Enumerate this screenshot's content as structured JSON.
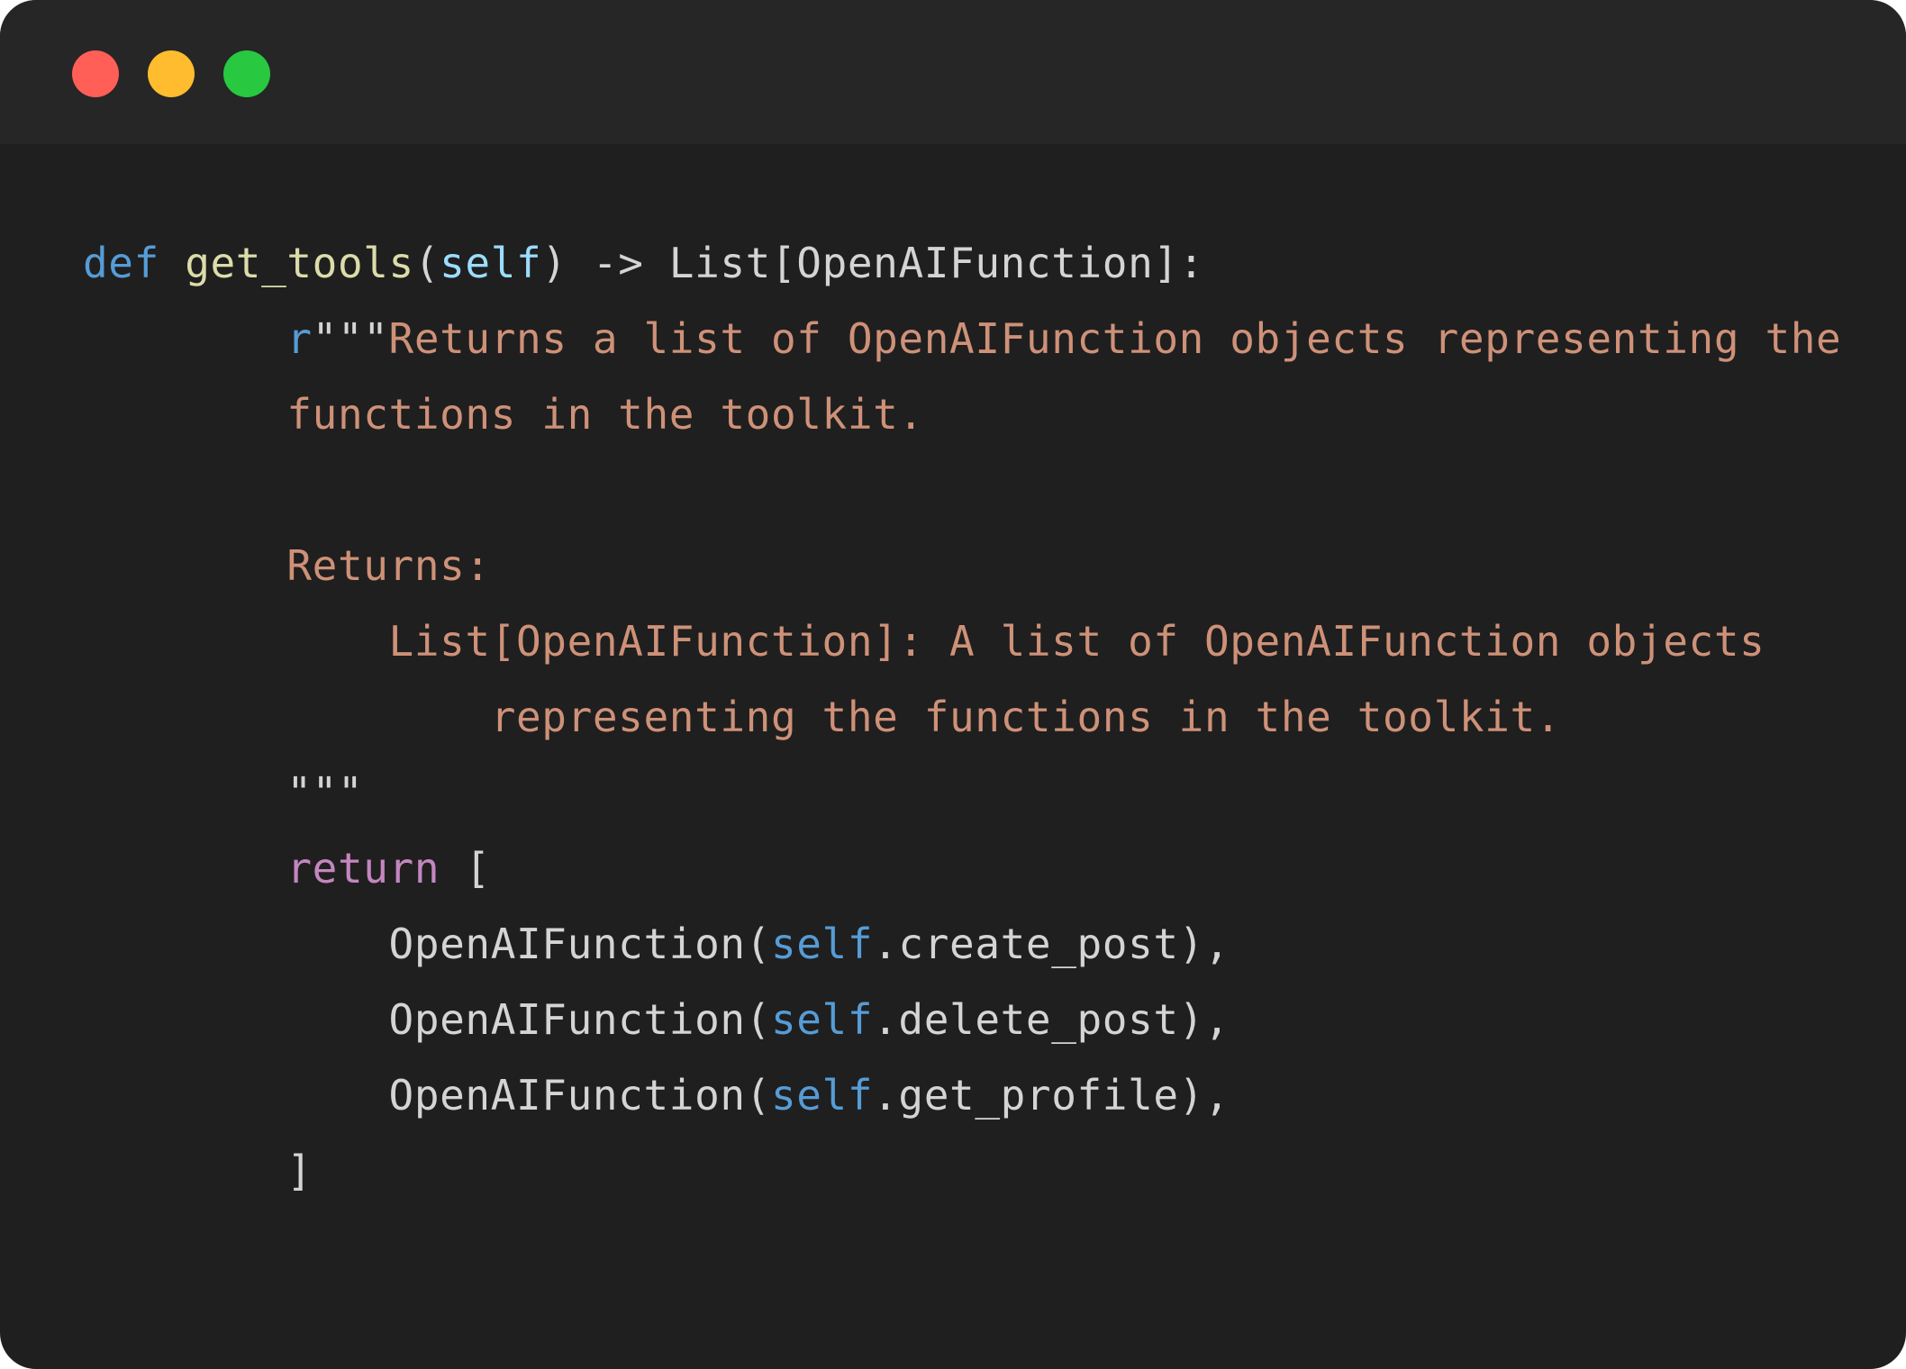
{
  "window": {
    "controls": {
      "close_color": "#ff5f57",
      "minimize_color": "#febc2e",
      "maximize_color": "#28c840"
    }
  },
  "theme": {
    "background": "#1f1f1f",
    "titlebar": "#262626",
    "keyword": "#569cd6",
    "function": "#dcdcaa",
    "param": "#9cdcfe",
    "default": "#d4d4d4",
    "string": "#ce9178",
    "control": "#c586c0"
  },
  "code": {
    "lines": [
      {
        "tokens": [
          {
            "t": "def",
            "c": "keyword"
          },
          {
            "t": " ",
            "c": "default"
          },
          {
            "t": "get_tools",
            "c": "function"
          },
          {
            "t": "(",
            "c": "default"
          },
          {
            "t": "self",
            "c": "param"
          },
          {
            "t": ") -> List[OpenAIFunction]:",
            "c": "default"
          }
        ]
      },
      {
        "tokens": [
          {
            "t": "        ",
            "c": "default"
          },
          {
            "t": "r",
            "c": "keyword"
          },
          {
            "t": "\"\"\"",
            "c": "default"
          },
          {
            "t": "Returns a list of OpenAIFunction objects representing the",
            "c": "string"
          }
        ]
      },
      {
        "tokens": [
          {
            "t": "        functions in the toolkit.",
            "c": "string"
          }
        ]
      },
      {
        "tokens": [
          {
            "t": "",
            "c": "string"
          }
        ]
      },
      {
        "tokens": [
          {
            "t": "        Returns:",
            "c": "string"
          }
        ]
      },
      {
        "tokens": [
          {
            "t": "            List[OpenAIFunction]: A list of OpenAIFunction objects",
            "c": "string"
          }
        ]
      },
      {
        "tokens": [
          {
            "t": "                representing the functions in the toolkit.",
            "c": "string"
          }
        ]
      },
      {
        "tokens": [
          {
            "t": "        \"\"\"",
            "c": "default"
          }
        ]
      },
      {
        "tokens": [
          {
            "t": "        ",
            "c": "default"
          },
          {
            "t": "return",
            "c": "control"
          },
          {
            "t": " [",
            "c": "default"
          }
        ]
      },
      {
        "tokens": [
          {
            "t": "            OpenAIFunction(",
            "c": "default"
          },
          {
            "t": "self",
            "c": "keyword"
          },
          {
            "t": ".create_post),",
            "c": "default"
          }
        ]
      },
      {
        "tokens": [
          {
            "t": "            OpenAIFunction(",
            "c": "default"
          },
          {
            "t": "self",
            "c": "keyword"
          },
          {
            "t": ".delete_post),",
            "c": "default"
          }
        ]
      },
      {
        "tokens": [
          {
            "t": "            OpenAIFunction(",
            "c": "default"
          },
          {
            "t": "self",
            "c": "keyword"
          },
          {
            "t": ".get_profile),",
            "c": "default"
          }
        ]
      },
      {
        "tokens": [
          {
            "t": "        ]",
            "c": "default"
          }
        ]
      }
    ]
  }
}
